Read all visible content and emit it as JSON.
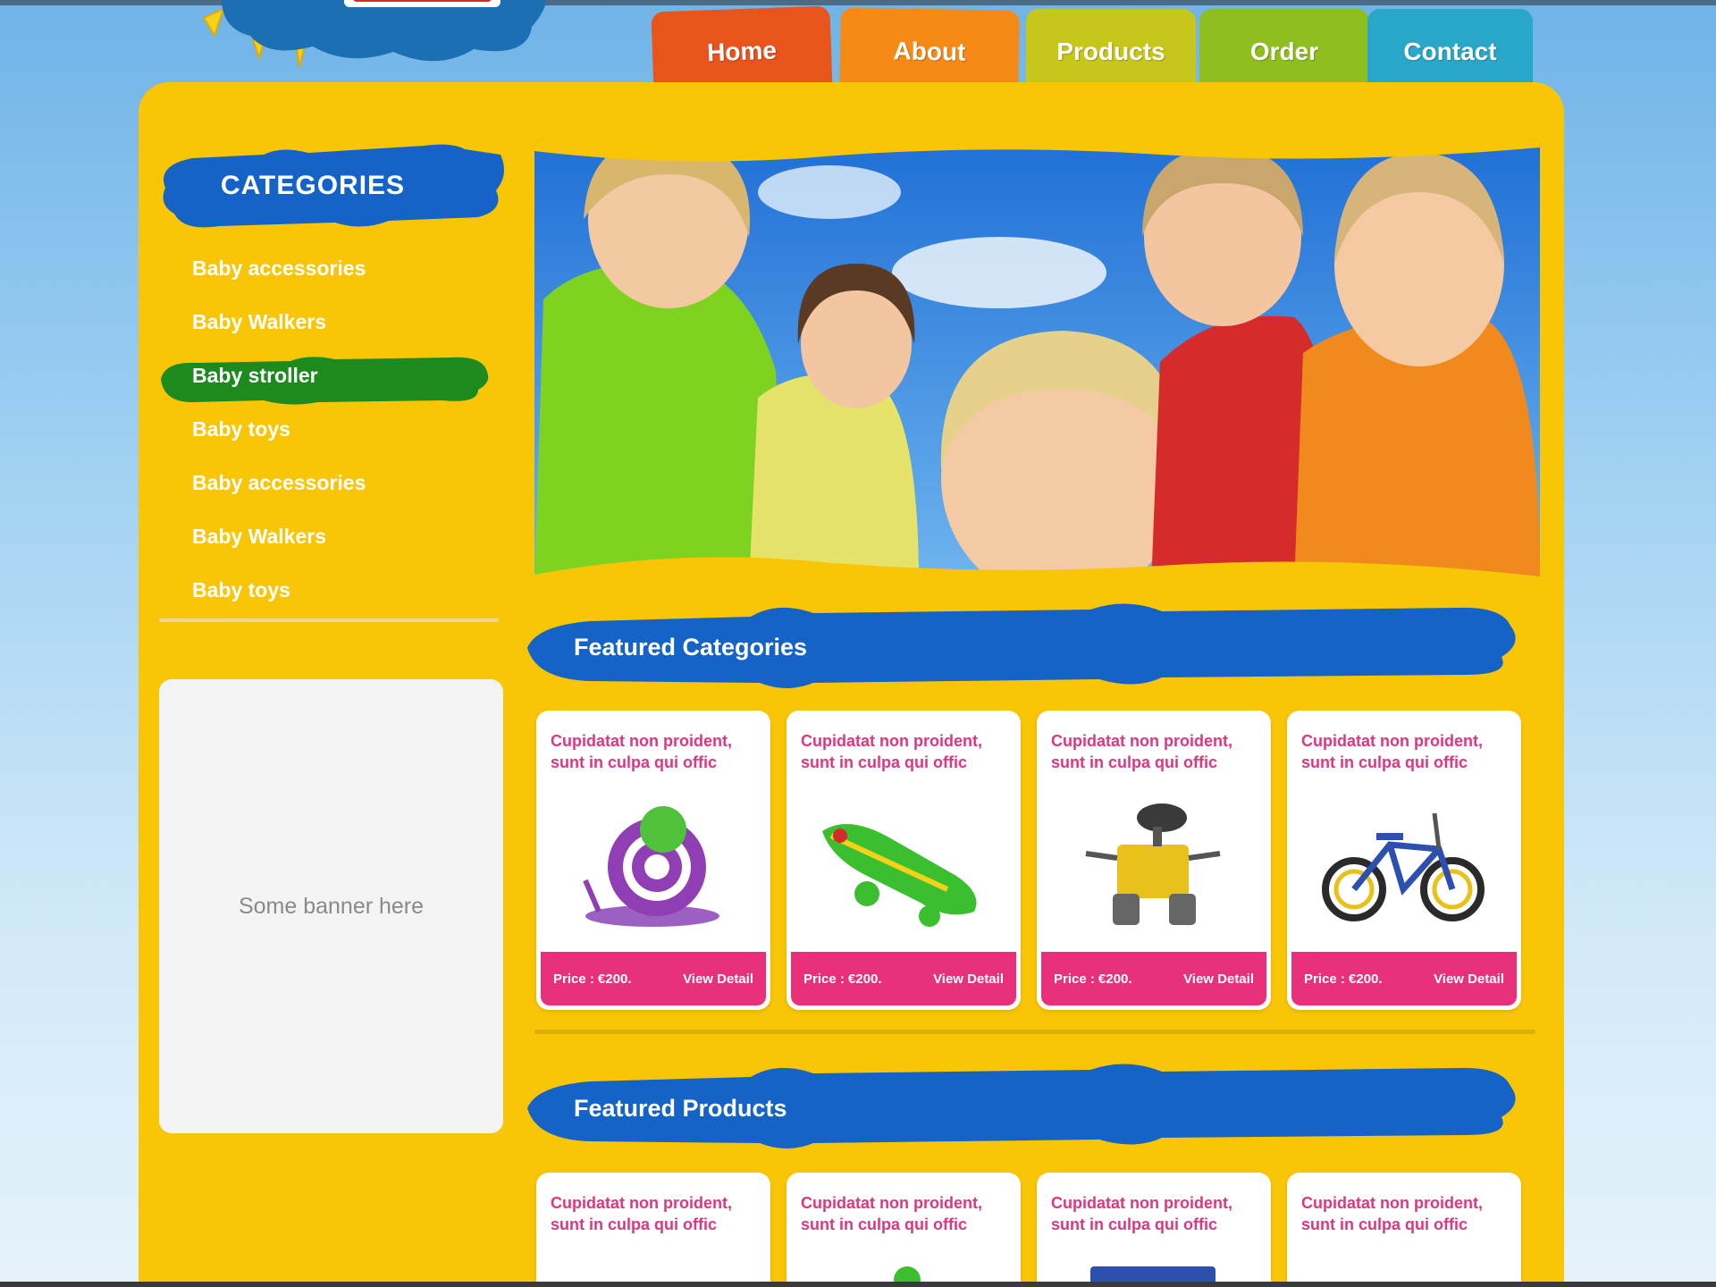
{
  "colors": {
    "panel": "#f9c607",
    "heading_blue": "#1563c6",
    "active_green": "#1c8a1c",
    "pink": "#e8317a"
  },
  "nav": {
    "items": [
      {
        "label": "Home",
        "color": "#e8541c"
      },
      {
        "label": "About",
        "color": "#f58a16"
      },
      {
        "label": "Products",
        "color": "#c7c61a"
      },
      {
        "label": "Order",
        "color": "#8fbf1e"
      },
      {
        "label": "Contact",
        "color": "#28a7c9"
      }
    ]
  },
  "sidebar": {
    "heading": "CATEGORIES",
    "items": [
      {
        "label": "Baby accessories"
      },
      {
        "label": "Baby Walkers"
      },
      {
        "label": "Baby stroller",
        "active": true
      },
      {
        "label": "Baby toys"
      },
      {
        "label": "Baby accessories"
      },
      {
        "label": "Baby Walkers"
      },
      {
        "label": "Baby toys"
      }
    ],
    "banner_text": "Some banner here"
  },
  "featured_categories": {
    "heading": "Featured Categories",
    "cards": [
      {
        "desc": "Cupidatat non proident, sunt in culpa qui offic",
        "price": "Price : €200.",
        "detail": "View Detail",
        "image": "snail-toy-icon"
      },
      {
        "desc": "Cupidatat non proident, sunt in culpa qui offic",
        "price": "Price : €200.",
        "detail": "View Detail",
        "image": "crocodile-toy-icon"
      },
      {
        "desc": "Cupidatat non proident, sunt in culpa qui offic",
        "price": "Price : €200.",
        "detail": "View Detail",
        "image": "robot-toy-icon"
      },
      {
        "desc": "Cupidatat non proident, sunt in culpa qui offic",
        "price": "Price : €200.",
        "detail": "View Detail",
        "image": "bicycle-toy-icon"
      }
    ]
  },
  "featured_products": {
    "heading": "Featured Products",
    "cards": [
      {
        "desc": "Cupidatat non proident, sunt in culpa qui offic"
      },
      {
        "desc": "Cupidatat non proident, sunt in culpa qui offic"
      },
      {
        "desc": "Cupidatat non proident, sunt in culpa qui offic"
      },
      {
        "desc": "Cupidatat non proident, sunt in culpa qui offic"
      }
    ]
  }
}
